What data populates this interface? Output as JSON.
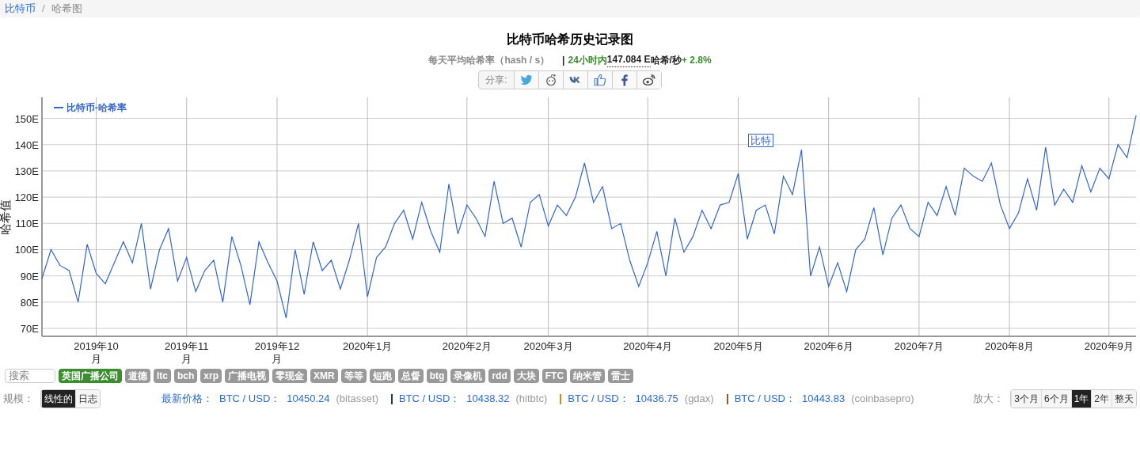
{
  "breadcrumb": {
    "separator": "/",
    "items": [
      {
        "label": "比特币",
        "link": true
      },
      {
        "label": "哈希图",
        "link": false
      }
    ]
  },
  "title": "比特币哈希历史记录图",
  "subtitle": {
    "metric": "每天平均哈希率（hash / s）",
    "separator": "|",
    "period": "24小时内",
    "value": "147.084 E",
    "unit": "哈希/秒",
    "change": "+ 2.8%"
  },
  "share": {
    "label": "分享:"
  },
  "chart": {
    "chart_data": {
      "type": "line",
      "grid": true,
      "ylabel": "哈希值",
      "ylim": [
        67,
        158
      ],
      "yticks": [
        {
          "value": 70,
          "label": "70E"
        },
        {
          "value": 80,
          "label": "80E"
        },
        {
          "value": 90,
          "label": "90E"
        },
        {
          "value": 100,
          "label": "100E"
        },
        {
          "value": 110,
          "label": "110E"
        },
        {
          "value": 120,
          "label": "120E"
        },
        {
          "value": 130,
          "label": "130E"
        },
        {
          "value": 140,
          "label": "140E"
        },
        {
          "value": 150,
          "label": "150E"
        }
      ],
      "categories": [
        null,
        null,
        null,
        null,
        null,
        null,
        "2019年10月",
        null,
        null,
        null,
        null,
        null,
        null,
        null,
        null,
        null,
        "2019年11月",
        null,
        null,
        null,
        null,
        null,
        null,
        null,
        null,
        null,
        "2019年12月",
        null,
        null,
        null,
        null,
        null,
        null,
        null,
        null,
        null,
        "2020年1月",
        null,
        null,
        null,
        null,
        null,
        null,
        null,
        null,
        null,
        null,
        "2020年2月",
        null,
        null,
        null,
        null,
        null,
        null,
        null,
        null,
        "2020年3月",
        null,
        null,
        null,
        null,
        null,
        null,
        null,
        null,
        null,
        null,
        "2020年4月",
        null,
        null,
        null,
        null,
        null,
        null,
        null,
        null,
        null,
        "2020年5月",
        null,
        null,
        null,
        null,
        null,
        null,
        null,
        null,
        null,
        "2020年6月",
        null,
        null,
        null,
        null,
        null,
        null,
        null,
        null,
        null,
        "2020年7月",
        null,
        null,
        null,
        null,
        null,
        null,
        null,
        null,
        null,
        "2020年8月",
        null,
        null,
        null,
        null,
        null,
        null,
        null,
        null,
        null,
        null,
        "2020年9月",
        null,
        null,
        null
      ],
      "series": [
        {
          "name": "比特币-哈希率",
          "color": "#3366cc",
          "values": [
            89,
            100,
            94,
            92,
            80,
            102,
            91,
            87,
            95,
            103,
            95,
            110,
            85,
            100,
            108,
            88,
            97,
            84,
            92,
            96,
            80,
            105,
            94,
            79,
            103,
            95,
            88,
            74,
            100,
            83,
            103,
            92,
            96,
            85,
            96,
            110,
            82,
            97,
            101,
            110,
            115,
            104,
            118,
            107,
            99,
            125,
            106,
            117,
            112,
            105,
            126,
            110,
            112,
            101,
            118,
            121,
            109,
            117,
            113,
            120,
            133,
            118,
            124,
            108,
            110,
            96,
            86,
            95,
            107,
            90,
            112,
            99,
            105,
            115,
            108,
            117,
            118,
            129,
            104,
            115,
            117,
            106,
            128,
            121,
            138,
            90,
            101,
            86,
            95,
            84,
            100,
            104,
            116,
            98,
            112,
            117,
            108,
            105,
            118,
            113,
            124,
            113,
            131,
            128,
            126,
            133,
            117,
            108,
            114,
            127,
            115,
            139,
            117,
            123,
            118,
            132,
            122,
            131,
            127,
            140,
            135,
            151
          ]
        }
      ],
      "annotations": [
        "比特"
      ]
    }
  },
  "tags": {
    "placeholder": "搜索",
    "items": [
      {
        "label": "英国广播公司",
        "selected": true
      },
      {
        "label": "道德",
        "selected": false
      },
      {
        "label": "ltc",
        "selected": false
      },
      {
        "label": "bch",
        "selected": false
      },
      {
        "label": "xrp",
        "selected": false
      },
      {
        "label": "广播电视",
        "selected": false
      },
      {
        "label": "零现金",
        "selected": false
      },
      {
        "label": "XMR",
        "selected": false
      },
      {
        "label": "等等",
        "selected": false
      },
      {
        "label": "短跑",
        "selected": false
      },
      {
        "label": "总督",
        "selected": false
      },
      {
        "label": "btg",
        "selected": false
      },
      {
        "label": "录像机",
        "selected": false
      },
      {
        "label": "rdd",
        "selected": false
      },
      {
        "label": "大块",
        "selected": false
      },
      {
        "label": "FTC",
        "selected": false
      },
      {
        "label": "纳米管",
        "selected": false
      },
      {
        "label": "雷士",
        "selected": false
      }
    ]
  },
  "scale": {
    "label": "规模：",
    "options": [
      {
        "label": "线性的",
        "selected": true
      },
      {
        "label": "日志",
        "selected": false
      }
    ]
  },
  "prices": {
    "label": "最新价格：",
    "items": [
      {
        "pair": "BTC / USD：",
        "price": "10450.24",
        "source": "(bitasset)"
      },
      {
        "pair": "BTC / USD：",
        "price": "10438.32",
        "source": "(hitbtc)",
        "color": "#1f3a5f"
      },
      {
        "pair": "BTC / USD：",
        "price": "10436.75",
        "source": "(gdax)",
        "color": "#d08a1a"
      },
      {
        "pair": "BTC / USD：",
        "price": "10443.83",
        "source": "(coinbasepro)",
        "color": "#a0522d"
      }
    ]
  },
  "zoom": {
    "label": "放大：",
    "options": [
      {
        "label": "3个月",
        "selected": false
      },
      {
        "label": "6个月",
        "selected": false
      },
      {
        "label": "1年",
        "selected": true
      },
      {
        "label": "2年",
        "selected": false
      },
      {
        "label": "整天",
        "selected": false
      }
    ]
  }
}
